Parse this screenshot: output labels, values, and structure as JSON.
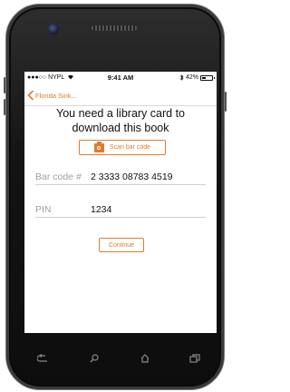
{
  "status_bar": {
    "carrier": "●●●○○ NYPL",
    "time": "9:41 AM",
    "battery_text": "42%",
    "battery_level": 0.42
  },
  "nav": {
    "back_label": "Florida Sink..."
  },
  "content": {
    "headline_line1": "You need a library card to",
    "headline_line2": "download this book",
    "scan_button_label": "Scan bar code",
    "barcode_label": "Bar code #",
    "barcode_value": "2 3333 08783 4519",
    "pin_label": "PIN",
    "pin_value": "1234",
    "continue_label": "Continue"
  },
  "colors": {
    "accent": "#e07b2c",
    "phone_body": "#141414"
  },
  "icons": {
    "wifi": "wifi-icon",
    "bluetooth": "bluetooth-icon",
    "battery": "battery-icon",
    "back": "chevron-left-icon",
    "camera": "camera-icon",
    "soft_back": "back-arrow-icon",
    "soft_search": "search-icon",
    "soft_home": "home-icon",
    "soft_recent": "recent-apps-icon"
  }
}
